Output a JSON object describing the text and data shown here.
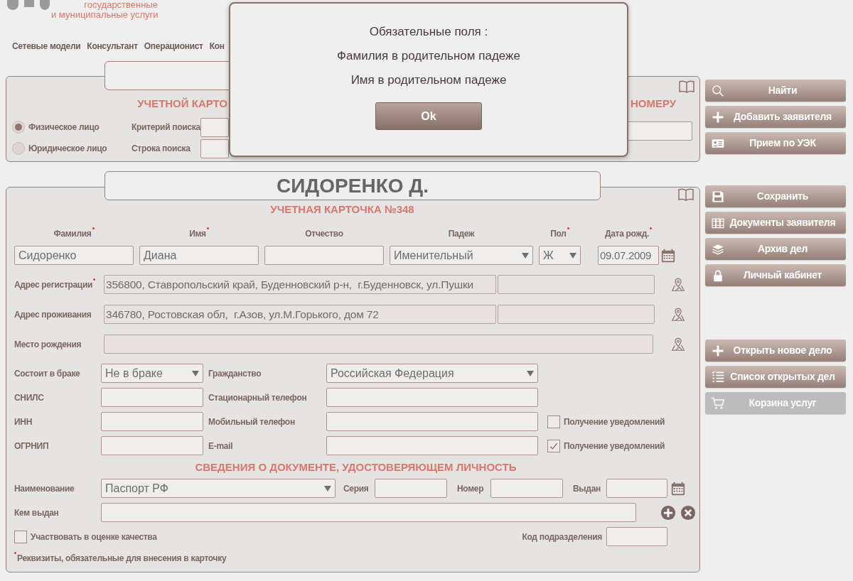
{
  "header": {
    "logo_lines": [
      "государственные",
      "и муниципальные услуги"
    ],
    "nav": [
      {
        "label": "Сетевые модели"
      },
      {
        "label": "Консультант"
      },
      {
        "label": "Операционист"
      },
      {
        "label": "Кон"
      }
    ]
  },
  "search_panel": {
    "heading_parts": [
      "УЧЕТНОЙ КАРТО",
      "НОМЕРУ"
    ],
    "person_types": [
      {
        "label": "Физическое лицо",
        "selected": true
      },
      {
        "label": "Юридическое лицо",
        "selected": false
      }
    ],
    "criteria_labels": [
      "Критерий поиска",
      "Строка поиска"
    ]
  },
  "card": {
    "title": "СИДОРЕНКО Д.",
    "subtitle": "УЧЕТНАЯ КАРТОЧКА №348",
    "name_fields": [
      {
        "label": "Фамилия",
        "required": true,
        "kind": "text",
        "value": "Сидоренко"
      },
      {
        "label": "Имя",
        "required": true,
        "kind": "text",
        "value": "Диана"
      },
      {
        "label": "Отчество",
        "required": false,
        "kind": "text"
      },
      {
        "label": "Падеж",
        "required": false,
        "kind": "select",
        "value": "Именительный"
      },
      {
        "label": "Пол",
        "required": true,
        "kind": "select",
        "value": "Ж"
      },
      {
        "label": "Дата рожд.",
        "required": true,
        "kind": "date",
        "value": "09.07.2009"
      }
    ],
    "addresses": [
      {
        "label": "Адрес регистрации",
        "required": true,
        "kind": "split",
        "value": "356800, Ставропольский край, Буденновский р-н,  г.Буденновск, ул.Пушки"
      },
      {
        "label": "Адрес проживания",
        "required": false,
        "kind": "split",
        "value": "346780, Ростовская обл,  г.Азов, ул.М.Горького, дом 72"
      },
      {
        "label": "Место рождения",
        "required": false,
        "kind": "single"
      }
    ],
    "contact_rows": [
      {
        "label": "Состоит в браке",
        "field": {
          "kind": "select",
          "value": "Не в браке"
        },
        "label_2": "Гражданство",
        "field_2": {
          "kind": "select",
          "value": "Российская Федерация"
        }
      },
      {
        "label": "СНИЛС",
        "field": {
          "kind": "text"
        },
        "label_2": "Стационарный телефон",
        "field_2": {
          "kind": "text"
        }
      },
      {
        "label": "ИНН",
        "field": {
          "kind": "text"
        },
        "label_2": "Мобильный телефон",
        "field_2": {
          "kind": "text"
        },
        "notification": {
          "label": "Получение уведомлений",
          "checked": false
        }
      },
      {
        "label": "ОГРНИП",
        "field": {
          "kind": "text"
        },
        "label_2": "E-mail",
        "field_2": {
          "kind": "text"
        },
        "notification": {
          "label": "Получение уведомлений",
          "checked": true
        }
      }
    ],
    "document": {
      "heading": "СВЕДЕНИЯ О ДОКУМЕНТЕ, УДОСТОВЕРЯЮЩЕМ ЛИЧНОСТЬ",
      "name_label": "Наименование",
      "name_value": "Паспорт РФ",
      "series_label": "Серия",
      "number_label": "Номер",
      "issued_date_label": "Выдан",
      "issued_by_label": "Кем выдан",
      "subdivision_label": "Код подразделения"
    },
    "quality": {
      "label": "Участвовать в оценке качества",
      "checked": false
    },
    "footnote": "Реквизиты, обязательные для внесения в карточку"
  },
  "action_groups": [
    {
      "buttons": [
        {
          "label": "Найти",
          "disabled": false
        },
        {
          "label": "Добавить заявителя",
          "disabled": false
        },
        {
          "label": "Прием по УЭК",
          "disabled": false
        }
      ]
    },
    {
      "buttons": [
        {
          "label": "Сохранить",
          "disabled": false
        },
        {
          "label": "Документы заявителя",
          "disabled": false
        },
        {
          "label": "Архив дел",
          "disabled": false
        },
        {
          "label": "Личный кабинет",
          "disabled": false
        }
      ]
    },
    {
      "buttons": [
        {
          "label": "Открыть новое дело",
          "disabled": false
        },
        {
          "label": "Список открытых дел",
          "disabled": false
        },
        {
          "label": "Корзина услуг",
          "disabled": true
        }
      ]
    }
  ],
  "modal": {
    "lines": [
      "Обязательные поля :",
      "Фамилия в родительном падеже",
      "Имя в родительном падеже"
    ],
    "button": "Ok"
  }
}
